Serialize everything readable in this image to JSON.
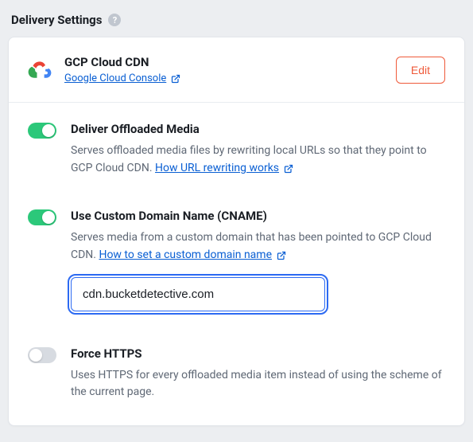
{
  "section": {
    "title": "Delivery Settings"
  },
  "provider": {
    "name": "GCP Cloud CDN",
    "console_link_label": "Google Cloud Console",
    "edit_label": "Edit"
  },
  "settings": {
    "deliver": {
      "enabled": true,
      "title": "Deliver Offloaded Media",
      "desc_prefix": "Serves offloaded media files by rewriting local URLs so that they point to GCP Cloud CDN. ",
      "link_label": "How URL rewriting works"
    },
    "custom_domain": {
      "enabled": true,
      "title": "Use Custom Domain Name (CNAME)",
      "desc_prefix": "Serves media from a custom domain that has been pointed to GCP Cloud CDN. ",
      "link_label": "How to set a custom domain name",
      "input_value": "cdn.bucketdetective.com"
    },
    "force_https": {
      "enabled": false,
      "title": "Force HTTPS",
      "desc": "Uses HTTPS for every offloaded media item instead of using the scheme of the current page."
    }
  }
}
